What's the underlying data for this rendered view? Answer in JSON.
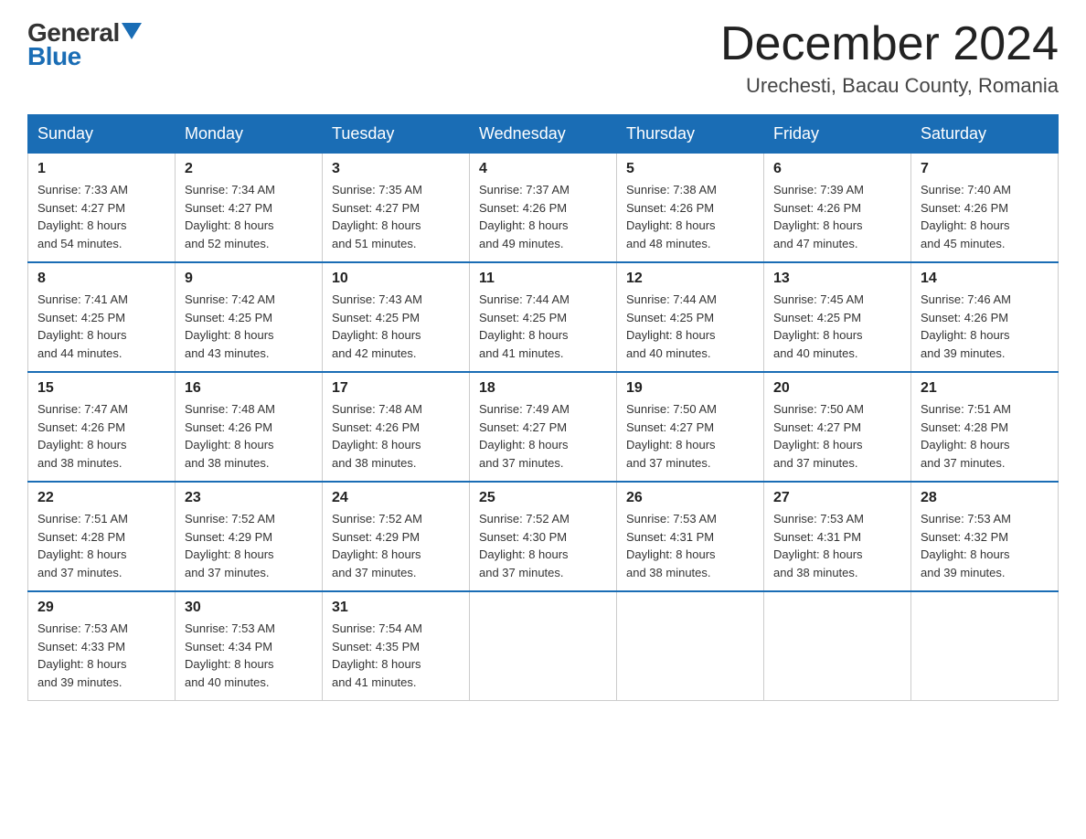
{
  "logo": {
    "general": "General",
    "blue": "Blue"
  },
  "title": "December 2024",
  "location": "Urechesti, Bacau County, Romania",
  "days_of_week": [
    "Sunday",
    "Monday",
    "Tuesday",
    "Wednesday",
    "Thursday",
    "Friday",
    "Saturday"
  ],
  "weeks": [
    [
      {
        "day": "1",
        "sunrise": "7:33 AM",
        "sunset": "4:27 PM",
        "daylight": "8 hours and 54 minutes."
      },
      {
        "day": "2",
        "sunrise": "7:34 AM",
        "sunset": "4:27 PM",
        "daylight": "8 hours and 52 minutes."
      },
      {
        "day": "3",
        "sunrise": "7:35 AM",
        "sunset": "4:27 PM",
        "daylight": "8 hours and 51 minutes."
      },
      {
        "day": "4",
        "sunrise": "7:37 AM",
        "sunset": "4:26 PM",
        "daylight": "8 hours and 49 minutes."
      },
      {
        "day": "5",
        "sunrise": "7:38 AM",
        "sunset": "4:26 PM",
        "daylight": "8 hours and 48 minutes."
      },
      {
        "day": "6",
        "sunrise": "7:39 AM",
        "sunset": "4:26 PM",
        "daylight": "8 hours and 47 minutes."
      },
      {
        "day": "7",
        "sunrise": "7:40 AM",
        "sunset": "4:26 PM",
        "daylight": "8 hours and 45 minutes."
      }
    ],
    [
      {
        "day": "8",
        "sunrise": "7:41 AM",
        "sunset": "4:25 PM",
        "daylight": "8 hours and 44 minutes."
      },
      {
        "day": "9",
        "sunrise": "7:42 AM",
        "sunset": "4:25 PM",
        "daylight": "8 hours and 43 minutes."
      },
      {
        "day": "10",
        "sunrise": "7:43 AM",
        "sunset": "4:25 PM",
        "daylight": "8 hours and 42 minutes."
      },
      {
        "day": "11",
        "sunrise": "7:44 AM",
        "sunset": "4:25 PM",
        "daylight": "8 hours and 41 minutes."
      },
      {
        "day": "12",
        "sunrise": "7:44 AM",
        "sunset": "4:25 PM",
        "daylight": "8 hours and 40 minutes."
      },
      {
        "day": "13",
        "sunrise": "7:45 AM",
        "sunset": "4:25 PM",
        "daylight": "8 hours and 40 minutes."
      },
      {
        "day": "14",
        "sunrise": "7:46 AM",
        "sunset": "4:26 PM",
        "daylight": "8 hours and 39 minutes."
      }
    ],
    [
      {
        "day": "15",
        "sunrise": "7:47 AM",
        "sunset": "4:26 PM",
        "daylight": "8 hours and 38 minutes."
      },
      {
        "day": "16",
        "sunrise": "7:48 AM",
        "sunset": "4:26 PM",
        "daylight": "8 hours and 38 minutes."
      },
      {
        "day": "17",
        "sunrise": "7:48 AM",
        "sunset": "4:26 PM",
        "daylight": "8 hours and 38 minutes."
      },
      {
        "day": "18",
        "sunrise": "7:49 AM",
        "sunset": "4:27 PM",
        "daylight": "8 hours and 37 minutes."
      },
      {
        "day": "19",
        "sunrise": "7:50 AM",
        "sunset": "4:27 PM",
        "daylight": "8 hours and 37 minutes."
      },
      {
        "day": "20",
        "sunrise": "7:50 AM",
        "sunset": "4:27 PM",
        "daylight": "8 hours and 37 minutes."
      },
      {
        "day": "21",
        "sunrise": "7:51 AM",
        "sunset": "4:28 PM",
        "daylight": "8 hours and 37 minutes."
      }
    ],
    [
      {
        "day": "22",
        "sunrise": "7:51 AM",
        "sunset": "4:28 PM",
        "daylight": "8 hours and 37 minutes."
      },
      {
        "day": "23",
        "sunrise": "7:52 AM",
        "sunset": "4:29 PM",
        "daylight": "8 hours and 37 minutes."
      },
      {
        "day": "24",
        "sunrise": "7:52 AM",
        "sunset": "4:29 PM",
        "daylight": "8 hours and 37 minutes."
      },
      {
        "day": "25",
        "sunrise": "7:52 AM",
        "sunset": "4:30 PM",
        "daylight": "8 hours and 37 minutes."
      },
      {
        "day": "26",
        "sunrise": "7:53 AM",
        "sunset": "4:31 PM",
        "daylight": "8 hours and 38 minutes."
      },
      {
        "day": "27",
        "sunrise": "7:53 AM",
        "sunset": "4:31 PM",
        "daylight": "8 hours and 38 minutes."
      },
      {
        "day": "28",
        "sunrise": "7:53 AM",
        "sunset": "4:32 PM",
        "daylight": "8 hours and 39 minutes."
      }
    ],
    [
      {
        "day": "29",
        "sunrise": "7:53 AM",
        "sunset": "4:33 PM",
        "daylight": "8 hours and 39 minutes."
      },
      {
        "day": "30",
        "sunrise": "7:53 AM",
        "sunset": "4:34 PM",
        "daylight": "8 hours and 40 minutes."
      },
      {
        "day": "31",
        "sunrise": "7:54 AM",
        "sunset": "4:35 PM",
        "daylight": "8 hours and 41 minutes."
      },
      null,
      null,
      null,
      null
    ]
  ],
  "labels": {
    "sunrise": "Sunrise:",
    "sunset": "Sunset:",
    "daylight": "Daylight:"
  }
}
